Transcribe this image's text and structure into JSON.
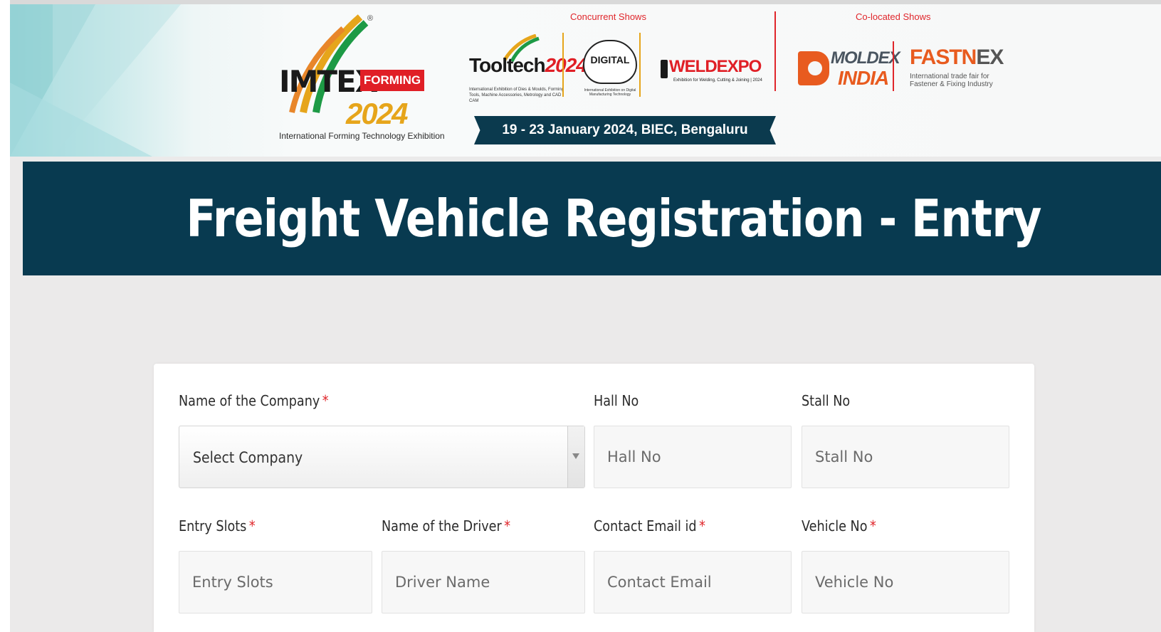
{
  "banner": {
    "imtex": {
      "word": "IMTEX",
      "forming": "FORMING",
      "year": "2024",
      "subtitle": "International Forming Technology Exhibition",
      "registered": "®"
    },
    "concurrent_label": "Concurrent Shows",
    "colocated_label": "Co-located Shows",
    "tooltech": {
      "word_left": "Tooltech",
      "word_right": "2024",
      "subtitle": "International Exhibition of Dies & Moulds, Forming Tools, Machine Accessories, Metrology and CAD / CAM"
    },
    "digital": {
      "word": "DIGITAL",
      "subtitle": "International Exhibition on Digital Manufacturing Technology"
    },
    "weldexpo": {
      "word": "WELDEXPO",
      "subtitle": "Exhibition for Welding, Cutting & Joining | 2024"
    },
    "date_ribbon": "19 - 23 January 2024, BIEC, Bengaluru",
    "moldex": {
      "word": "MOLDEX",
      "india": "INDIA"
    },
    "fastnex": {
      "word_left": "FASTN",
      "word_right": "EX",
      "subtitle": "International trade fair for Fastener & Fixing Industry"
    },
    "colors": {
      "accent_red": "#e0262b",
      "navy": "#083a50",
      "orange": "#e85b1f"
    }
  },
  "page_title": "Freight Vehicle Registration - Entry",
  "form": {
    "company": {
      "label": "Name of the Company",
      "required": "*",
      "value": "Select Company"
    },
    "hall": {
      "label": "Hall No",
      "placeholder": "Hall No"
    },
    "stall": {
      "label": "Stall No",
      "placeholder": "Stall No"
    },
    "entry_slots": {
      "label": "Entry Slots",
      "required": "*",
      "placeholder": "Entry Slots"
    },
    "driver": {
      "label": "Name of the Driver",
      "required": "*",
      "placeholder": "Driver Name"
    },
    "email": {
      "label": "Contact Email id",
      "required": "*",
      "placeholder": "Contact Email"
    },
    "vehicle": {
      "label": "Vehicle No",
      "required": "*",
      "placeholder": "Vehicle No"
    }
  }
}
